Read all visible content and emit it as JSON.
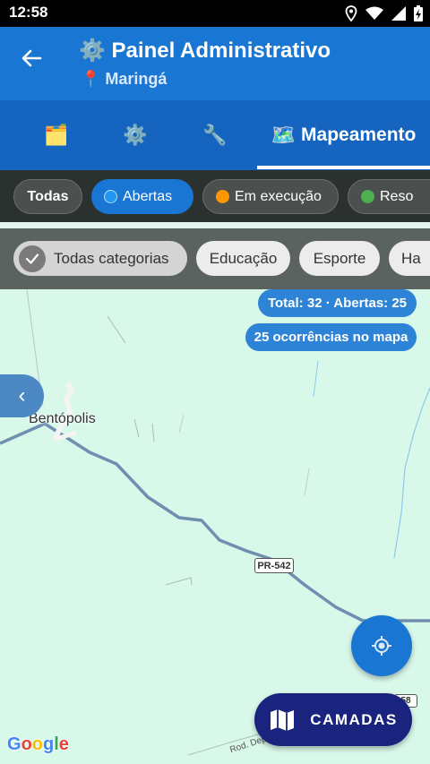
{
  "status_bar": {
    "time": "12:58",
    "icons": [
      "location-icon",
      "wifi-icon",
      "signal-icon",
      "battery-icon"
    ]
  },
  "app_bar": {
    "title": "⚙️ Painel Administrativo",
    "subtitle": "📍 Maringá",
    "accent": "#1976d2"
  },
  "tabs": [
    {
      "icon": "🗂️",
      "label": "",
      "active": false
    },
    {
      "icon": "⚙️",
      "label": "",
      "active": false
    },
    {
      "icon": "🔧",
      "label": "",
      "active": false
    },
    {
      "icon": "🗺️",
      "label": "Mapeamento",
      "active": true
    }
  ],
  "status_filters": [
    {
      "label": "Todas",
      "color": ""
    },
    {
      "label": "Abertas",
      "color": "#2196f3"
    },
    {
      "label": "Em execução",
      "color": "#ff9800"
    },
    {
      "label": "Reso",
      "color": "#4caf50"
    }
  ],
  "category_filters": [
    {
      "label": "Todas categorias",
      "selected": true
    },
    {
      "label": "Educação",
      "selected": false
    },
    {
      "label": "Esporte",
      "selected": false
    },
    {
      "label": "Ha",
      "selected": false
    }
  ],
  "map": {
    "summary": "Total: 32 · Abertas: 25",
    "count_label": "25 ocorrências no mapa",
    "place_label": "Bentópolis",
    "road_badge": "PR-542",
    "road_badge_2": "58",
    "road_text": "Rod. Dep",
    "attribution": "Google",
    "side_handle": "‹",
    "layers_button": "CAMADAS"
  }
}
